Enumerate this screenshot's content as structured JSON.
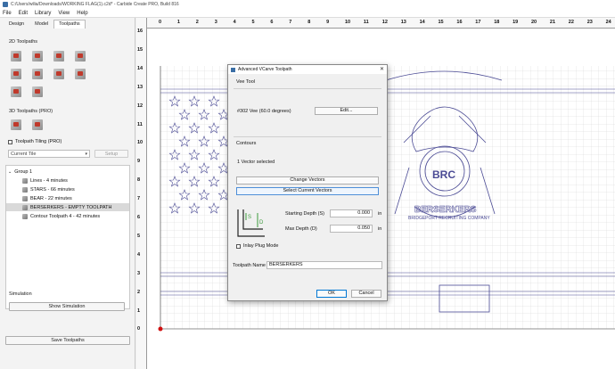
{
  "window": {
    "title": "C:/Users/wilia/Downloads/WORKING FLAG(1).c2d* - Carbide Create PRO, Build 816"
  },
  "menu": [
    "File",
    "Edit",
    "Library",
    "View",
    "Help"
  ],
  "left_panel": {
    "tabs": [
      "Design",
      "Model",
      "Toolpaths"
    ],
    "active_tab": "Toolpaths",
    "section_2d": "2D Toolpaths",
    "section_3d": "3D Toolpaths (PRO)",
    "tiling_label": "Toolpath Tiling (PRO)",
    "current_tile": "Current Tile",
    "setup_label": "Setup",
    "tree": {
      "group": "Group 1",
      "items": [
        "Lines - 4 minutes",
        "STARS - 66 minutes",
        "BEAR - 22 minutes",
        "BERSERKERS - EMPTY TOOLPATH",
        "Contour Toolpath 4 - 42 minutes"
      ],
      "selected_index": 3
    },
    "simulation_label": "Simulation",
    "show_simulation": "Show Simulation",
    "save_toolpaths": "Save Toolpaths"
  },
  "rulers": {
    "top": [
      "0",
      "1",
      "2",
      "3",
      "4",
      "5",
      "6",
      "7",
      "8",
      "9",
      "10",
      "11",
      "12",
      "13",
      "14",
      "15",
      "16",
      "17",
      "18",
      "19",
      "20",
      "21",
      "22",
      "23",
      "24"
    ],
    "left": [
      "16",
      "15",
      "14",
      "13",
      "12",
      "11",
      "10",
      "9",
      "8",
      "7",
      "6",
      "5",
      "4",
      "3",
      "2",
      "1",
      "0"
    ]
  },
  "artwork": {
    "badge": "BRC",
    "name": "BERSERKERS",
    "subtitle": "BRIDGEPORT RECRUITING COMPANY"
  },
  "dialog": {
    "title": "Advanced VCarve Toolpath",
    "vee_tool_label": "Vee Tool",
    "tool_name": "#302 Vee (60.0 degrees)",
    "edit_button": "Edit...",
    "contours_label": "Contours",
    "vector_status": "1 Vector selected",
    "change_vectors": "Change Vectors",
    "select_current": "Select Current Vectors",
    "starting_depth_label": "Starting Depth (S)",
    "starting_depth_value": "0.000",
    "max_depth_label": "Max Depth (D)",
    "max_depth_value": "0.050",
    "unit": "in",
    "inlay_label": "Inlay Plug Mode",
    "toolpath_name_label": "Toolpath Name",
    "toolpath_name_value": "BERSERKERS",
    "ok": "OK",
    "cancel": "Cancel",
    "diagram_s": "S",
    "diagram_d": "D"
  },
  "colors": {
    "vector": "#4a4a94",
    "grid": "#d4d4d4",
    "accent": "#0078d4",
    "origin": "#d01010"
  }
}
